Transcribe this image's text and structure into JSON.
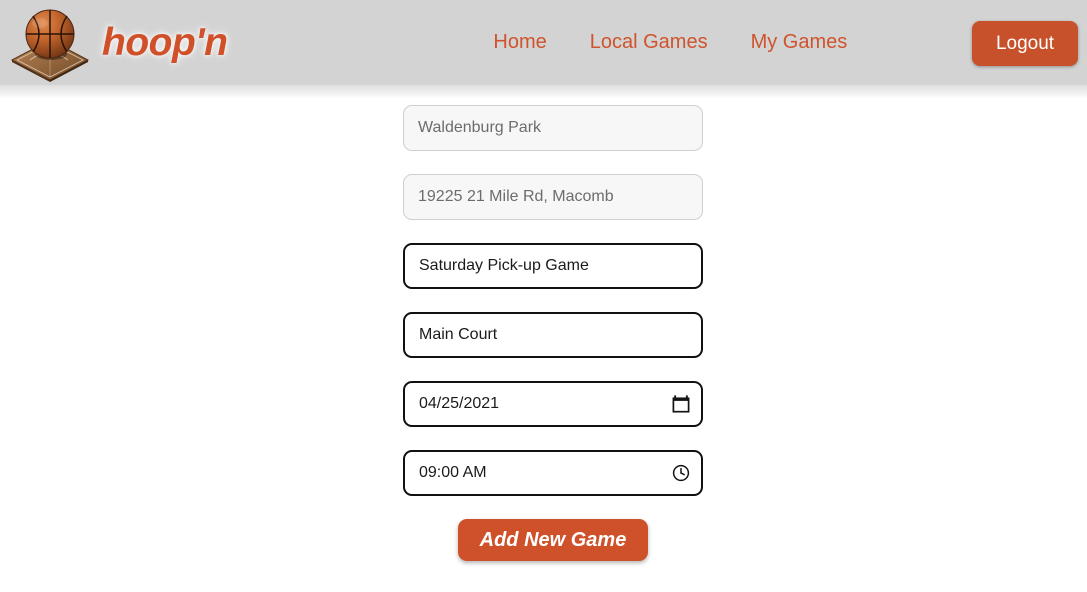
{
  "header": {
    "brand_name": "hoop'n",
    "logo_icon": "basketball-on-court-icon",
    "nav_links": [
      {
        "label": "Home",
        "name": "nav-link-home"
      },
      {
        "label": "Local Games",
        "name": "nav-link-local-games"
      },
      {
        "label": "My Games",
        "name": "nav-link-my-games"
      }
    ],
    "logout_label": "Logout",
    "background_color": "#d3d3d3",
    "accent_color": "#cf532c"
  },
  "form": {
    "fields": [
      {
        "name": "park-name-input",
        "value": "Waldenburg Park",
        "state": "muted",
        "icon": null
      },
      {
        "name": "park-address-input",
        "value": "19225 21 Mile Rd, Macomb",
        "state": "muted",
        "icon": null
      },
      {
        "name": "game-title-input",
        "value": "Saturday Pick-up Game",
        "state": "active",
        "icon": null
      },
      {
        "name": "court-name-input",
        "value": "Main Court",
        "state": "active",
        "icon": null
      },
      {
        "name": "game-date-input",
        "value": "04/25/2021",
        "state": "active",
        "icon": "calendar-icon"
      },
      {
        "name": "game-time-input",
        "value": "09:00 AM",
        "state": "active",
        "icon": "clock-icon"
      }
    ],
    "submit_label": "Add New Game",
    "submit_color": "#cf5129"
  }
}
